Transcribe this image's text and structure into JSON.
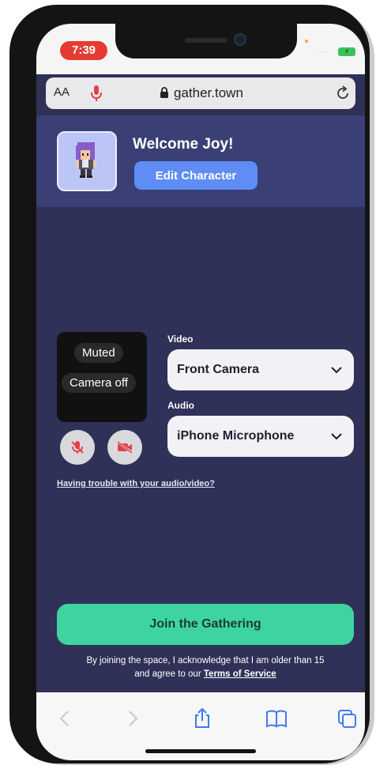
{
  "status_bar": {
    "time": "7:39",
    "signal": "....",
    "battery_icon": "battery-charging-icon"
  },
  "browser": {
    "text_size_label": "AA",
    "url": "gather.town",
    "icons": {
      "mic": "microphone-icon",
      "lock": "lock-icon",
      "reload": "reload-icon"
    }
  },
  "welcome": {
    "title": "Welcome Joy!",
    "edit_button": "Edit Character"
  },
  "preview": {
    "muted_label": "Muted",
    "camera_off_label": "Camera off"
  },
  "video": {
    "label": "Video",
    "selected": "Front Camera"
  },
  "audio": {
    "label": "Audio",
    "selected": "iPhone Microphone"
  },
  "help_link": "Having trouble with your audio/video?",
  "join_button": "Join the Gathering",
  "disclaimer": {
    "line1": "By joining the space, I acknowledge that I am older than 15",
    "line2_prefix": "and agree to our",
    "tos_link": "Terms of Service"
  },
  "colors": {
    "background": "#2f3158",
    "header_band": "#3a4076",
    "accent_blue": "#5f8df5",
    "join_green": "#3ed4a0",
    "mute_red": "#e0404a"
  },
  "toolbar": {
    "icons": [
      "back-icon",
      "forward-icon",
      "share-icon",
      "bookmarks-icon",
      "tabs-icon"
    ]
  }
}
